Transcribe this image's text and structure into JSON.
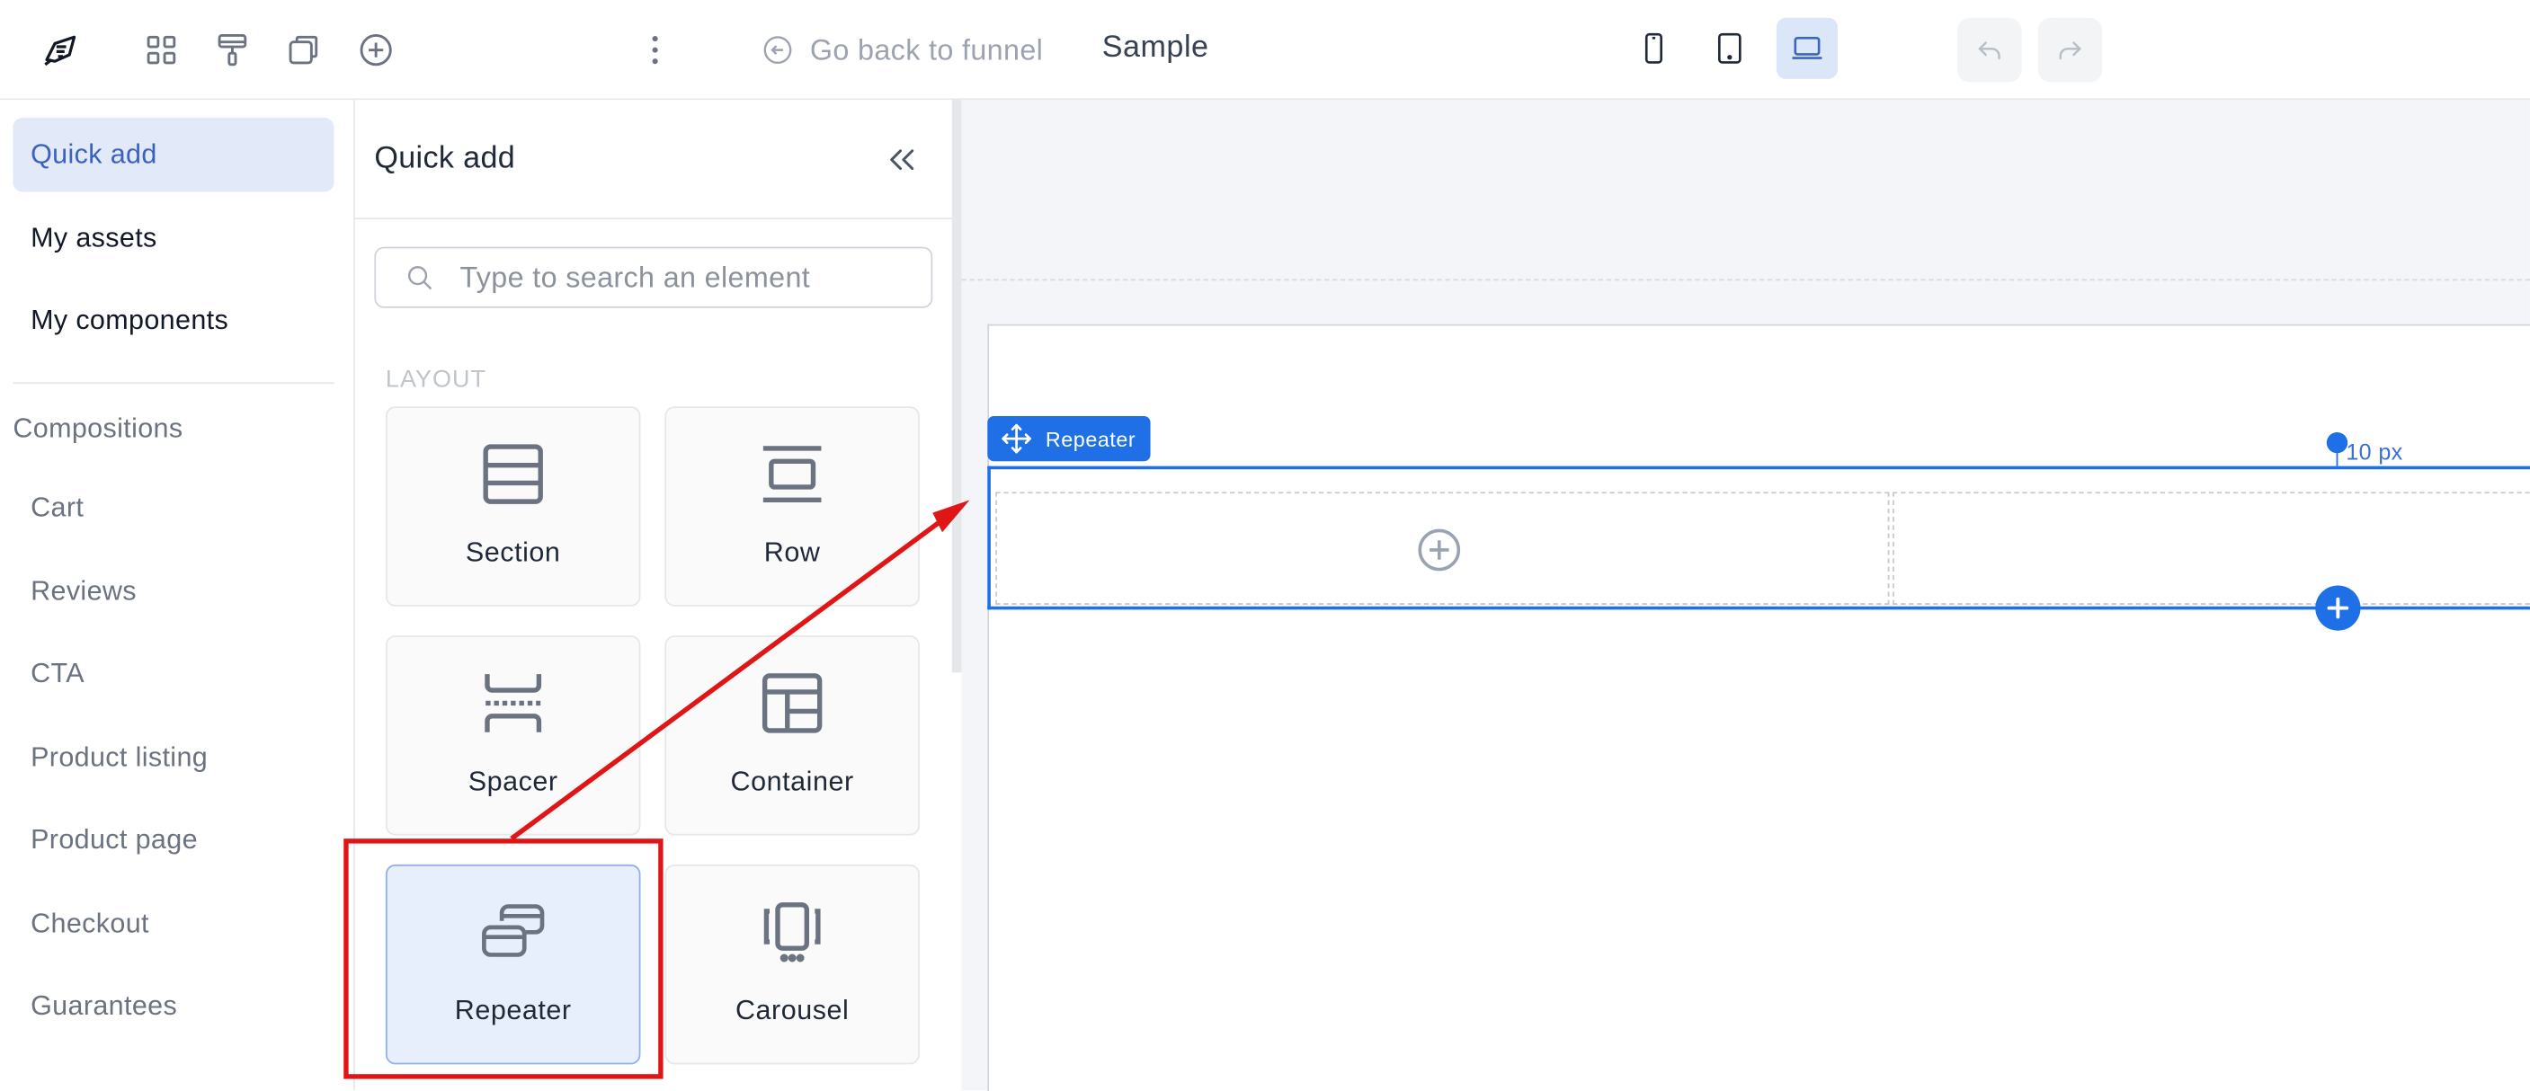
{
  "topbar": {
    "logo_icon": "rocket-logo-icon",
    "tools": [
      "grid-icon",
      "paint-roller-icon",
      "copy-icon",
      "plus-circle-icon"
    ],
    "more_icon": "more-vertical-icon",
    "back_label": "Go back to funnel",
    "page_name": "Sample",
    "devices": [
      "mobile",
      "tablet",
      "desktop"
    ],
    "active_device": "desktop",
    "undo_icon": "undo-icon",
    "redo_icon": "redo-icon"
  },
  "leftnav": {
    "items": [
      {
        "label": "Quick add",
        "active": true
      },
      {
        "label": "My assets",
        "active": false
      },
      {
        "label": "My components",
        "active": false
      }
    ],
    "compositions_heading": "Compositions",
    "compositions": [
      "Cart",
      "Reviews",
      "CTA",
      "Product listing",
      "Product page",
      "Checkout",
      "Guarantees"
    ]
  },
  "panel": {
    "title": "Quick add",
    "search_placeholder": "Type to search an element",
    "section_label": "LAYOUT",
    "tiles": [
      {
        "label": "Section",
        "icon": "section-icon"
      },
      {
        "label": "Row",
        "icon": "row-icon"
      },
      {
        "label": "Spacer",
        "icon": "spacer-icon"
      },
      {
        "label": "Container",
        "icon": "container-icon"
      },
      {
        "label": "Repeater",
        "icon": "repeater-icon",
        "selected": true
      },
      {
        "label": "Carousel",
        "icon": "carousel-icon"
      }
    ]
  },
  "canvas": {
    "repeater_tag": "Repeater",
    "spacing_label": "10 px"
  },
  "colors": {
    "accent": "#1f6fe6",
    "annotation": "#e01616",
    "active_nav_bg": "#e2e9f8"
  }
}
